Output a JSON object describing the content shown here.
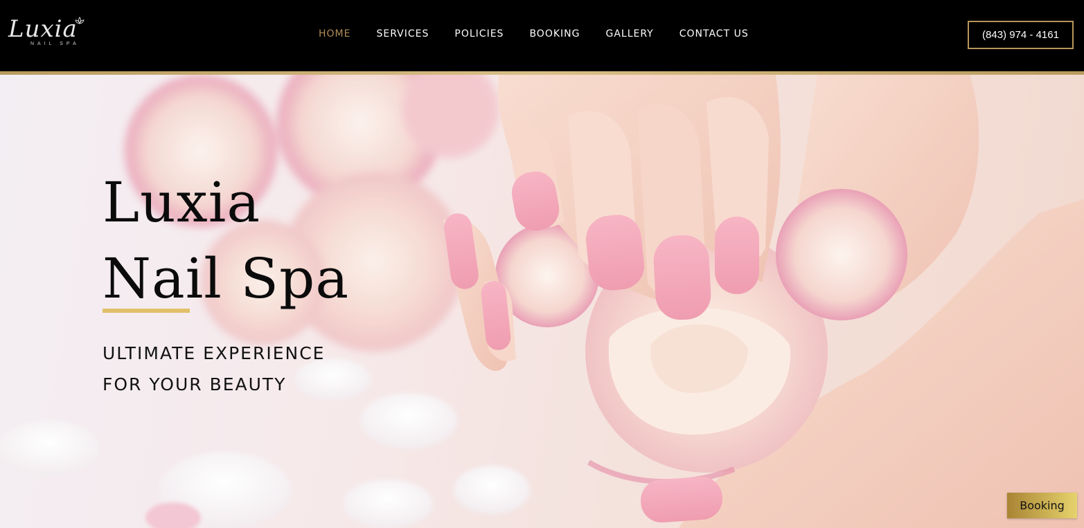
{
  "brand": {
    "logo_script": "Luxia",
    "logo_sub": "NAIL SPA",
    "lotus_icon": "lotus-icon"
  },
  "nav": {
    "items": [
      {
        "label": "HOME",
        "active": true
      },
      {
        "label": "SERVICES",
        "active": false
      },
      {
        "label": "POLICIES",
        "active": false
      },
      {
        "label": "BOOKING",
        "active": false
      },
      {
        "label": "GALLERY",
        "active": false
      },
      {
        "label": "CONTACT US",
        "active": false
      }
    ]
  },
  "header": {
    "phone": "(843) 974 - 4161"
  },
  "hero": {
    "title_line1": "Luxia",
    "title_line2": "Nail Spa",
    "subtitle_line1": "ULTIMATE EXPERIENCE",
    "subtitle_line2": "FOR YOUR BEAUTY"
  },
  "floating": {
    "booking_label": "Booking"
  },
  "colors": {
    "header_bg": "#000000",
    "gold": "#e2bf69",
    "nav_active": "#b08d57",
    "text_dark": "#0b0b0b"
  }
}
